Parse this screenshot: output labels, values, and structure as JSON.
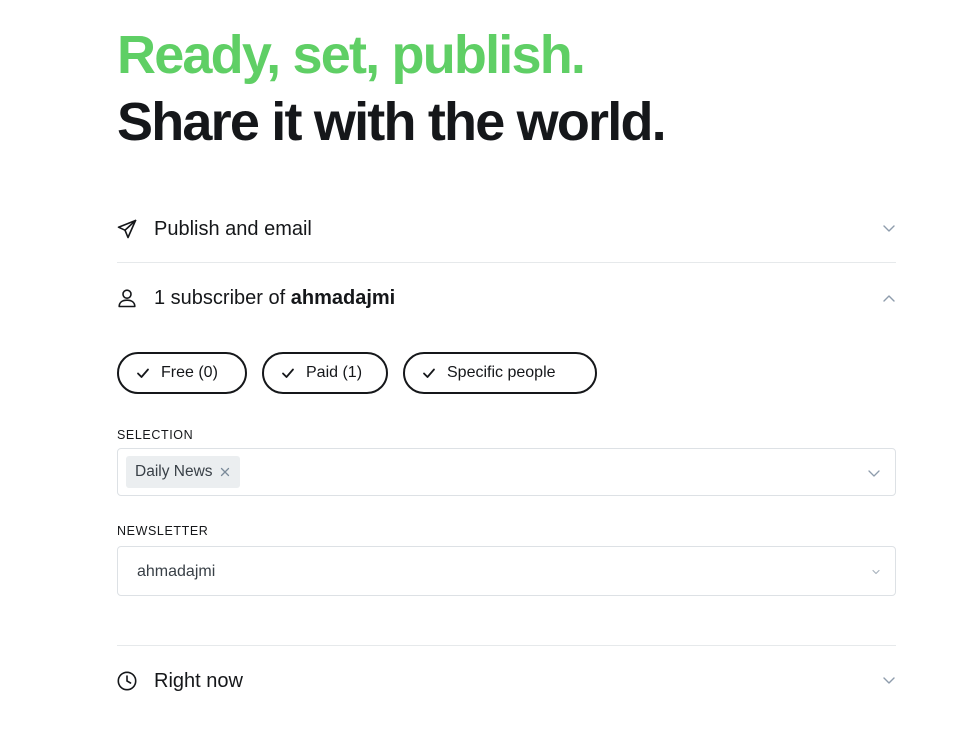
{
  "headline": {
    "line1": "Ready, set, publish.",
    "line2": "Share it with the world."
  },
  "sections": {
    "publish": {
      "label": "Publish and email",
      "icon": "send-icon"
    },
    "audience": {
      "prefix": "1 subscriber of ",
      "site": "ahmadajmi",
      "icon": "user-icon"
    },
    "schedule": {
      "label": "Right now",
      "icon": "clock-icon"
    }
  },
  "filters": [
    {
      "label": "Free (0)",
      "checked": true
    },
    {
      "label": "Paid (1)",
      "checked": true
    },
    {
      "label": "Specific people",
      "checked": true
    }
  ],
  "selection": {
    "label": "SELECTION",
    "tags": [
      "Daily News"
    ]
  },
  "newsletter": {
    "label": "NEWSLETTER",
    "value": "ahmadajmi"
  },
  "colors": {
    "accent": "#5fcf65",
    "text": "#15171a",
    "border": "#dde1e5"
  }
}
